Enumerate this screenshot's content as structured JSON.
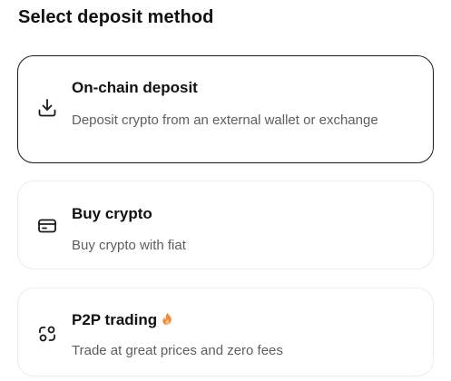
{
  "page": {
    "title": "Select deposit method"
  },
  "methods": [
    {
      "title": "On-chain deposit",
      "description": "Deposit crypto from an external wallet or exchange",
      "icon": "download-icon",
      "selected": true
    },
    {
      "title": "Buy crypto",
      "description": "Buy crypto with fiat",
      "icon": "card-icon",
      "selected": false
    },
    {
      "title": "P2P trading",
      "description": "Trade at great prices and zero fees",
      "icon": "p2p-icon",
      "badge_icon": "fire-icon",
      "selected": false
    }
  ],
  "colors": {
    "text": "#111111",
    "subtext": "#5e5e5e",
    "card_border": "#ececec",
    "selected_border": "#1a1a1a",
    "fire_accent": "#f08a3c"
  }
}
